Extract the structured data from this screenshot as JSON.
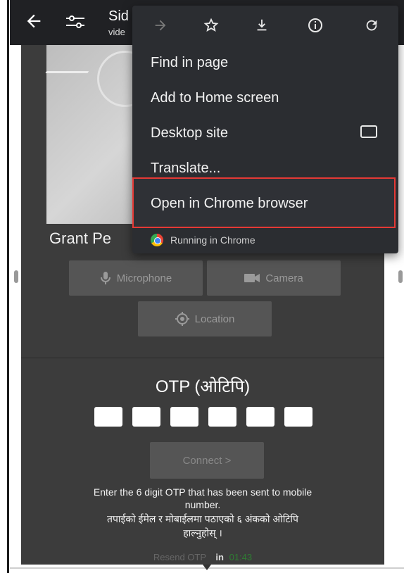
{
  "toolbar": {
    "back_icon": "arrow-left-icon",
    "settings_icon": "tune-icon",
    "title": "Sid",
    "subtitle": "vide"
  },
  "preview": {
    "name": "Grant Pe"
  },
  "permissions": {
    "microphone": "Microphone",
    "camera": "Camera",
    "location": "Location"
  },
  "otp": {
    "title": "OTP (ओटिपि)",
    "box_count": 6,
    "connect_label": "Connect  >",
    "helper_en_1": "Enter the 6 digit OTP that has been sent to mobile",
    "helper_en_2": "number.",
    "helper_ne_1": "तपाईको ईमेल र मोबाईलमा पठाएको ६ अंकको ओटिपि",
    "helper_ne_2": "हाल्नुहोस् ।",
    "resend_label": "Resend OTP",
    "in_label": "in",
    "timer": "01:43"
  },
  "menu": {
    "icons": [
      "forward-arrow-icon",
      "star-icon",
      "download-icon",
      "info-icon",
      "refresh-icon"
    ],
    "items": {
      "find": "Find in page",
      "add_home": "Add to Home screen",
      "desktop": "Desktop site",
      "translate": "Translate...",
      "open_chrome": "Open in Chrome browser"
    },
    "running": "Running in Chrome",
    "highlight_color": "#e53935"
  }
}
